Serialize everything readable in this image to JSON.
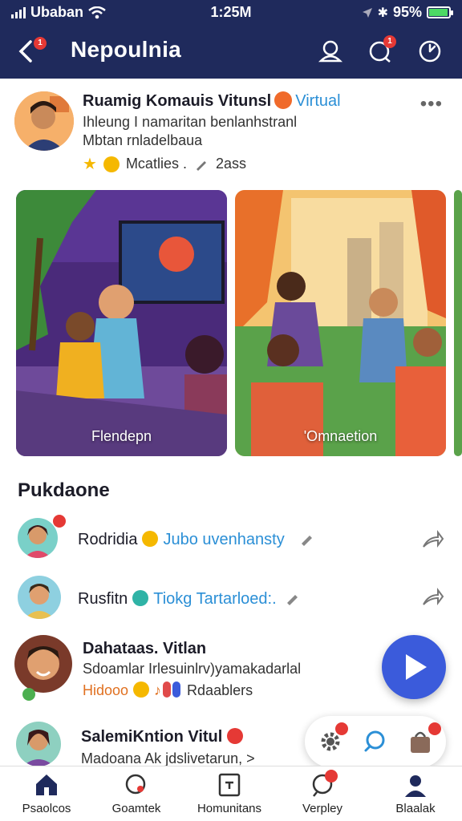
{
  "status": {
    "carrier": "Ubaban",
    "time": "1:25M",
    "battery": "95%",
    "battery_level": 0.95
  },
  "header": {
    "title": "Nepoulnia",
    "back_badge": "1",
    "chat_badge": "1"
  },
  "profile": {
    "name": "Ruamig Komauis Vitunsl",
    "tag": "Virtual",
    "line1": "Ihleung I namaritan benlanhstranl",
    "line2": "Mbtan rnladelbaua",
    "meta_label": "Mcatlies .",
    "meta_count": "2ass"
  },
  "cards": [
    {
      "label": "Flendepn"
    },
    {
      "label": "'Omnaetion"
    }
  ],
  "section": {
    "title": "Pukdaone"
  },
  "list": [
    {
      "name": "Rodridia",
      "tag": "Jubo uvenhansty"
    },
    {
      "name": "Rusfitn",
      "tag": "Tiokg Tartarloed:."
    },
    {
      "name": "Dahataas. Vitlan",
      "line1": "Sdoamlar Irlesuinlrv)yamakadarlal",
      "line2": "Hidooo",
      "line3": "Rdaablers"
    },
    {
      "name": "SalemiKntion Vitul",
      "line1": "Madoana Ak jdslivetarun, >"
    }
  ],
  "tabs": [
    {
      "label": "Psaolcos"
    },
    {
      "label": "Goamtek"
    },
    {
      "label": "Homunitans"
    },
    {
      "label": "Verpley"
    },
    {
      "label": "Blaalak"
    }
  ],
  "colors": {
    "header_bg": "#1f2a5c",
    "accent": "#2b8fd6",
    "fab": "#3b5bdb",
    "badge": "#e53935"
  }
}
